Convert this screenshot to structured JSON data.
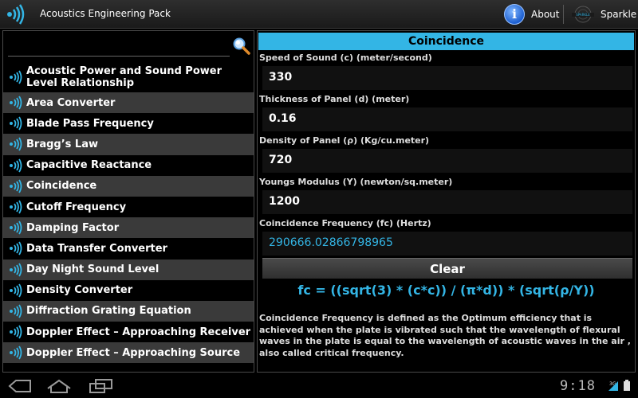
{
  "app": {
    "title": "Acoustics Engineering Pack",
    "about_label": "About",
    "sparkle_label": "Sparkle"
  },
  "search": {
    "placeholder": "",
    "value": ""
  },
  "list": [
    {
      "label": "Acoustic Power and Sound Power Level Relationship"
    },
    {
      "label": "Area Converter"
    },
    {
      "label": "Blade Pass Frequency"
    },
    {
      "label": "Bragg’s Law"
    },
    {
      "label": "Capacitive Reactance"
    },
    {
      "label": "Coincidence"
    },
    {
      "label": "Cutoff Frequency"
    },
    {
      "label": "Damping Factor"
    },
    {
      "label": "Data Transfer Converter"
    },
    {
      "label": "Day Night Sound Level"
    },
    {
      "label": "Density Converter"
    },
    {
      "label": "Diffraction Grating Equation"
    },
    {
      "label": "Doppler Effect – Approaching Receiver"
    },
    {
      "label": "Doppler Effect – Approaching Source"
    }
  ],
  "calc": {
    "title": "Coincidence",
    "fields": [
      {
        "label": "Speed of Sound (c) (meter/second)",
        "value": "330"
      },
      {
        "label": "Thickness of Panel (d) (meter)",
        "value": "0.16"
      },
      {
        "label": "Density of Panel (ρ) (Kg/cu.meter)",
        "value": "720"
      },
      {
        "label": "Youngs Modulus (Y) (newton/sq.meter)",
        "value": "1200"
      }
    ],
    "result": {
      "label": "Coincidence Frequency (fc) (Hertz)",
      "value": "290666.02866798965"
    },
    "clear_label": "Clear",
    "formula": "fc = ((sqrt(3) * (c*c)) / (π*d)) * (sqrt(ρ/Y))",
    "description": "Coincidence Frequency is defined as the Optimum efficiency that is achieved when the plate is vibrated such that the wavelength of flexural waves in the plate is equal to the wavelength of acoustic waves in the air , also called critical frequency."
  },
  "status": {
    "time": "9:18",
    "network": "3G"
  },
  "colors": {
    "accent": "#33b5e5",
    "row_alt": "#3a3a3a",
    "background": "#000000"
  },
  "icons": {
    "app": "sound-wave-icon",
    "about": "info-icon",
    "search": "search-icon",
    "list_item": "sound-wave-icon",
    "nav_back": "back-icon",
    "nav_home": "home-icon",
    "nav_recent": "recent-apps-icon"
  }
}
